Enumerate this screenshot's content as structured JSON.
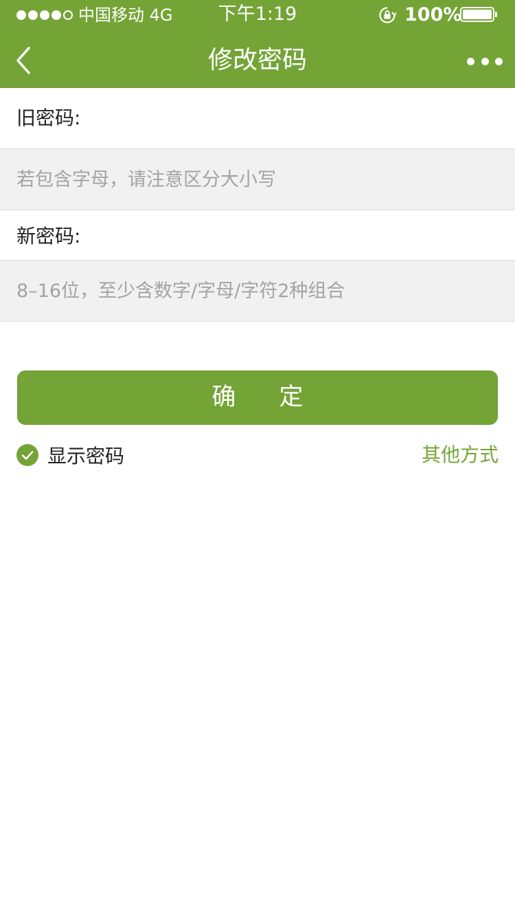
{
  "status_bar": {
    "carrier": "中国移动  4G",
    "time": "下午1:19",
    "battery": "100%",
    "signal_bars_filled": 5
  },
  "nav": {
    "title": "修改密码",
    "back_icon": "chevron-left-icon",
    "more_icon": "more-dots-icon"
  },
  "form": {
    "old_password": {
      "label": "旧密码:",
      "placeholder": "若包含字母，请注意区分大小写",
      "value": ""
    },
    "new_password": {
      "label": "新密码:",
      "placeholder": "8–16位，至少含数字/字母/字符2种组合",
      "value": ""
    },
    "confirm_label": "确 定"
  },
  "options": {
    "show_password_label": "显示密码",
    "show_password_checked": true,
    "other_method_label": "其他方式"
  },
  "colors": {
    "brand": "#74a436",
    "input_bg": "#f1f1f1",
    "placeholder": "#a3a3a3"
  }
}
